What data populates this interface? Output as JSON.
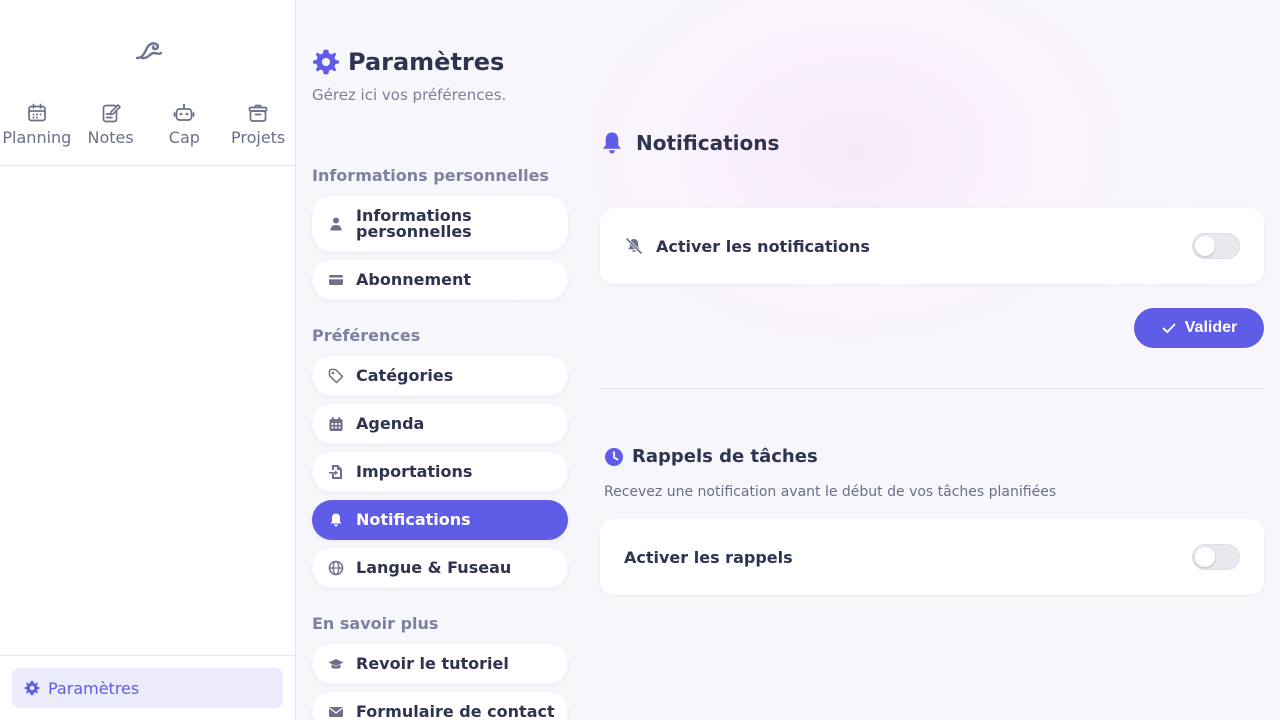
{
  "nav": {
    "items": [
      {
        "label": "Planning",
        "icon": "calendar-icon"
      },
      {
        "label": "Notes",
        "icon": "note-edit-icon"
      },
      {
        "label": "Cap",
        "icon": "robot-icon"
      },
      {
        "label": "Projets",
        "icon": "archive-box-icon"
      }
    ],
    "settings_label": "Paramètres"
  },
  "header": {
    "title": "Paramètres",
    "subtitle": "Gérez ici vos préférences."
  },
  "settings_menu": {
    "section_personal": "Informations personnelles",
    "personal_items": [
      {
        "label": "Informations personnelles",
        "icon": "user-icon"
      },
      {
        "label": "Abonnement",
        "icon": "credit-card-icon"
      }
    ],
    "section_prefs": "Préférences",
    "pref_items": [
      {
        "label": "Catégories",
        "icon": "tag-icon"
      },
      {
        "label": "Agenda",
        "icon": "calendar-grid-icon"
      },
      {
        "label": "Importations",
        "icon": "file-import-icon"
      },
      {
        "label": "Notifications",
        "icon": "bell-icon",
        "active": true
      },
      {
        "label": "Langue & Fuseau",
        "icon": "globe-icon"
      }
    ],
    "section_more": "En savoir plus",
    "more_items": [
      {
        "label": "Revoir le tutoriel",
        "icon": "graduation-cap-icon"
      },
      {
        "label": "Formulaire de contact",
        "icon": "envelope-icon"
      }
    ]
  },
  "notifications": {
    "title": "Notifications",
    "enable_label": "Activer les notifications",
    "enable_on": false,
    "validate_label": "Valider"
  },
  "reminders": {
    "title": "Rappels de tâches",
    "description": "Recevez une notification avant le début de vos tâches planifiées",
    "enable_label": "Activer les rappels",
    "enable_on": false
  },
  "colors": {
    "accent": "#5f5ce8",
    "text": "#2e3450",
    "muted": "#7d82a0"
  }
}
